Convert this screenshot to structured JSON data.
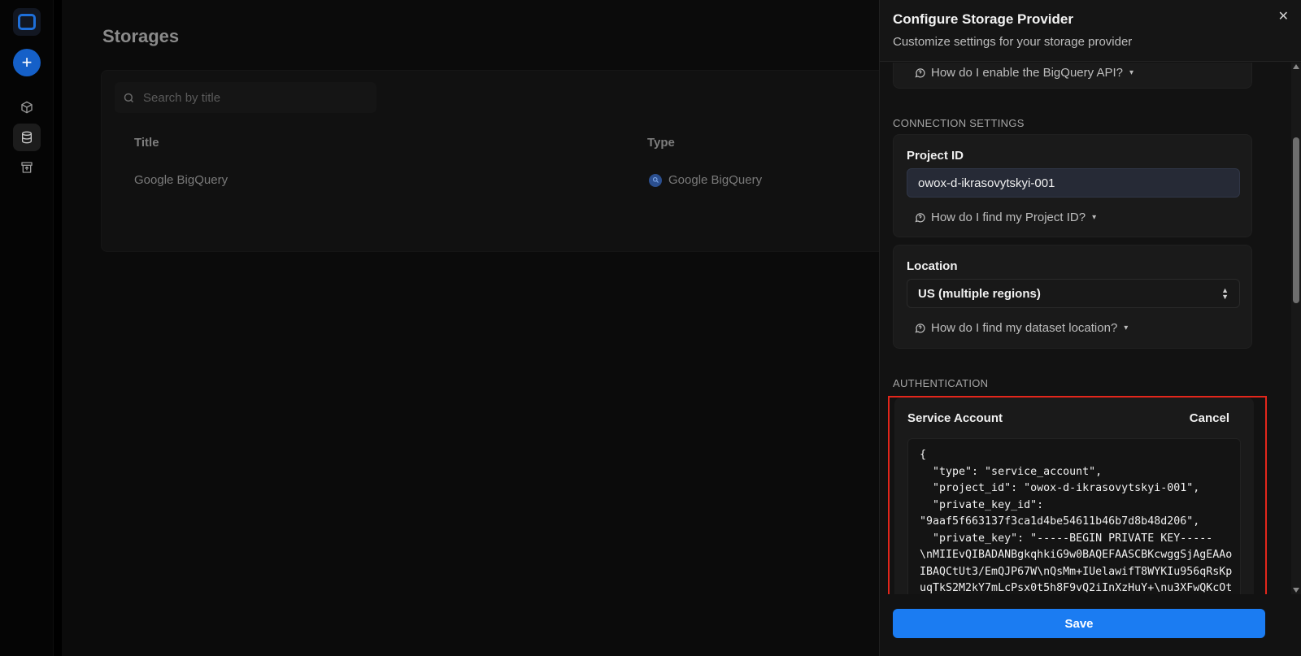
{
  "sidebar": {
    "items": [
      {
        "icon": "cube-icon"
      },
      {
        "icon": "database-icon",
        "active": true
      },
      {
        "icon": "archive-icon"
      }
    ]
  },
  "main": {
    "title": "Storages",
    "search_placeholder": "Search by title",
    "columns": [
      "Title",
      "Type"
    ],
    "rows": [
      {
        "title": "Google BigQuery",
        "type": "Google BigQuery"
      }
    ]
  },
  "panel": {
    "title": "Configure Storage Provider",
    "subtitle": "Customize settings for your storage provider",
    "help_api": "How do I enable the BigQuery API?",
    "connection_heading": "CONNECTION SETTINGS",
    "project_label": "Project ID",
    "project_value": "owox-d-ikrasovytskyi-001",
    "help_project": "How do I find my Project ID?",
    "location_label": "Location",
    "location_value": "US (multiple regions)",
    "help_location": "How do I find my dataset location?",
    "auth_heading": "AUTHENTICATION",
    "service_account_label": "Service Account",
    "cancel_label": "Cancel",
    "json_lines": [
      "{",
      "  \"type\": \"service_account\",",
      "  \"project_id\": \"owox-d-ikrasovytskyi-001\",",
      "  \"private_key_id\":",
      "\"9aaf5f663137f3ca1d4be54611b46b7d8b48d206\",",
      "  \"private_key\": \"-----BEGIN PRIVATE KEY-----",
      "\\nMIIEvQIBADANBgkqhkiG9w0BAQEFAASCBKcwggSjAgEAAo",
      "IBAQCtUt3/EmQJP67W\\nQsMm+IUelawifT8WYKIu956qRsKp",
      "uqTkS2M2kY7mLcPsx0t5h8F9vQ2iInXzHuY+\\nu3XFwQKcOt"
    ],
    "save_label": "Save",
    "accent_color": "#1b7cf2",
    "highlight_color": "#e3261b"
  }
}
